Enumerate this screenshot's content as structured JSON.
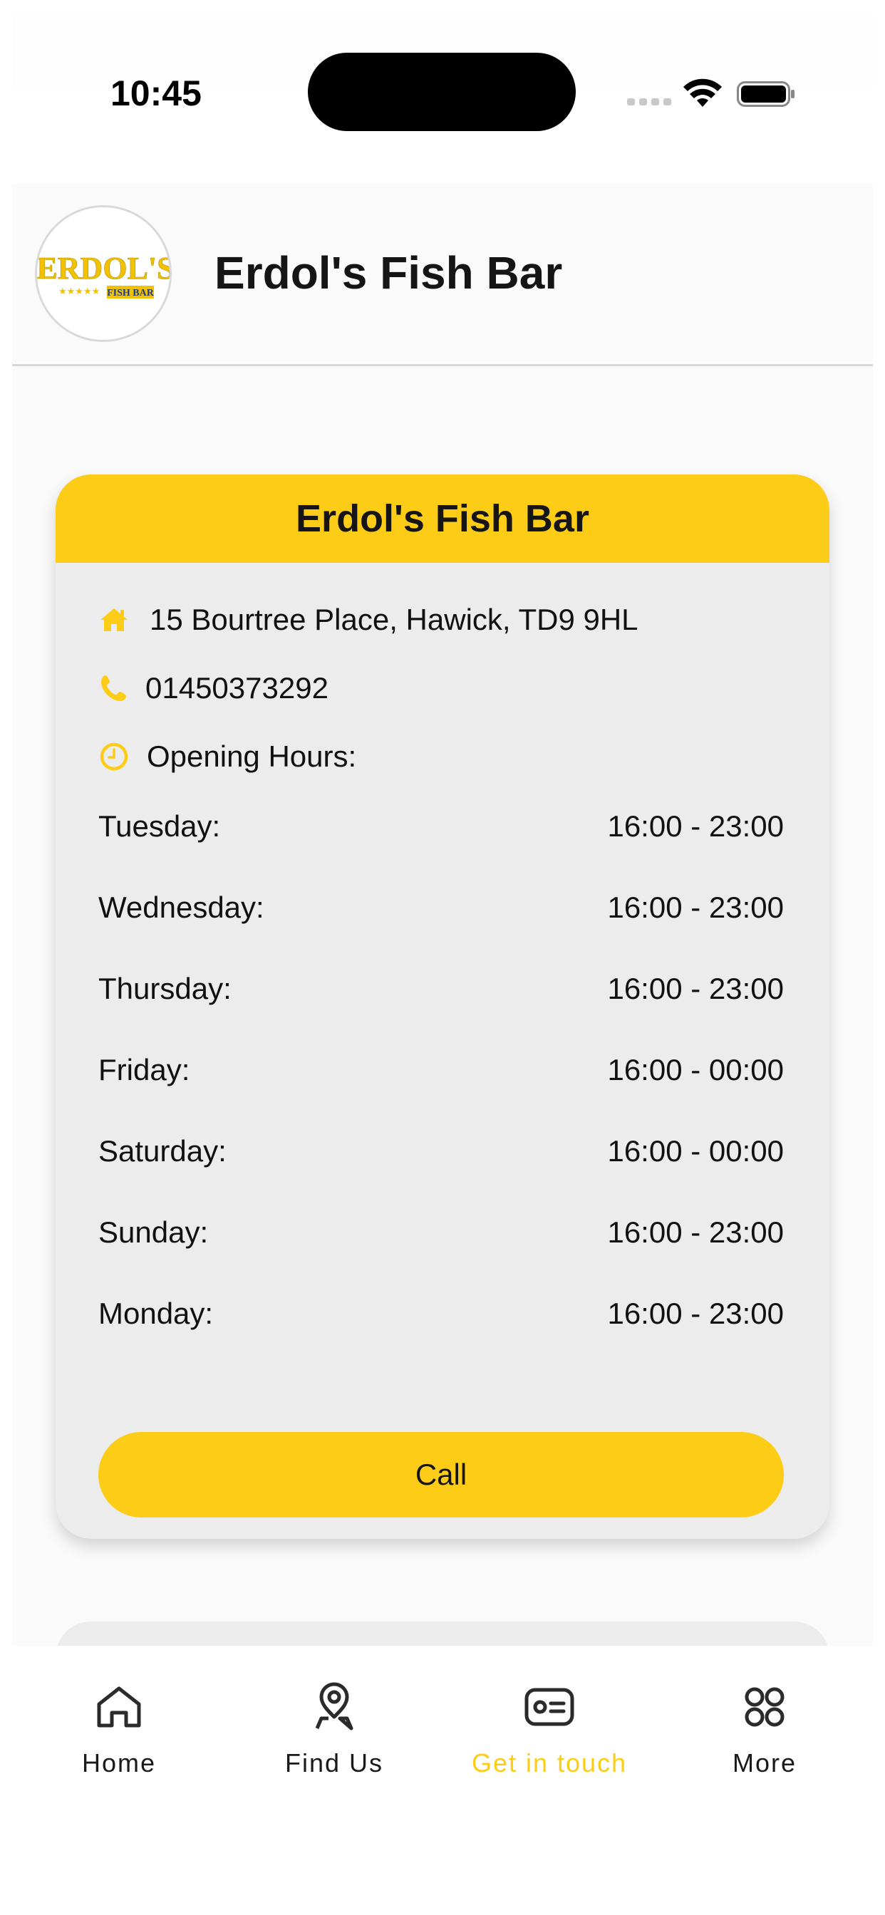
{
  "status_bar": {
    "time": "10:45"
  },
  "header": {
    "title": "Erdol's Fish Bar",
    "logo_text": "ERDOL'S",
    "logo_subtext": "FISH BAR"
  },
  "card": {
    "title": "Erdol's Fish Bar",
    "address": "15 Bourtree Place, Hawick, TD9 9HL",
    "phone": "01450373292",
    "hours_label": "Opening Hours:",
    "hours": [
      {
        "day": "Tuesday:",
        "time": "16:00 - 23:00"
      },
      {
        "day": "Wednesday:",
        "time": "16:00 - 23:00"
      },
      {
        "day": "Thursday:",
        "time": "16:00 - 23:00"
      },
      {
        "day": "Friday:",
        "time": "16:00 - 00:00"
      },
      {
        "day": "Saturday:",
        "time": "16:00 - 00:00"
      },
      {
        "day": "Sunday:",
        "time": "16:00 - 23:00"
      },
      {
        "day": "Monday:",
        "time": "16:00 - 23:00"
      }
    ],
    "call_label": "Call"
  },
  "bottom_nav": {
    "items": [
      {
        "label": "Home",
        "icon": "home-icon",
        "active": false
      },
      {
        "label": "Find Us",
        "icon": "location-pin-icon",
        "active": false
      },
      {
        "label": "Get in touch",
        "icon": "contact-card-icon",
        "active": true
      },
      {
        "label": "More",
        "icon": "grid-icon",
        "active": false
      }
    ]
  },
  "colors": {
    "accent": "#fccc17",
    "card_bg": "#ececec",
    "text": "#151515"
  }
}
